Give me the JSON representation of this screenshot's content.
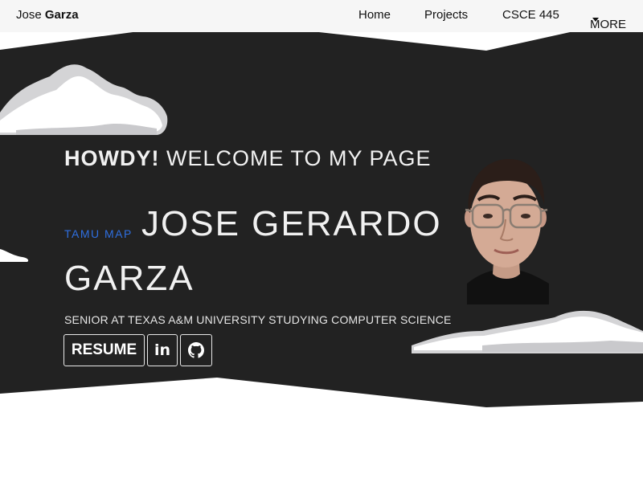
{
  "brand": {
    "first": "Jose ",
    "last": "Garza"
  },
  "nav": {
    "home": "Home",
    "projects": "Projects",
    "course": "CSCE 445",
    "more": "MORE"
  },
  "hero": {
    "howdy": "HOWDY!",
    "welcome": " WELCOME TO MY PAGE",
    "map_link": "TAMU MAP",
    "name_line1": "JOSE GERARDO",
    "name_line2": "GARZA",
    "subtitle": "SENIOR AT TEXAS A&M UNIVERSITY STUDYING COMPUTER SCIENCE"
  },
  "buttons": {
    "resume": "RESUME",
    "linkedin_icon": "linkedin-icon",
    "github_icon": "github-icon"
  },
  "colors": {
    "hero_background": "#222222",
    "topbar": "#f6f6f6",
    "link_blue": "#2f6fe0",
    "cloud": "#ffffff",
    "cloud_shadow": "#d4d4d6"
  }
}
